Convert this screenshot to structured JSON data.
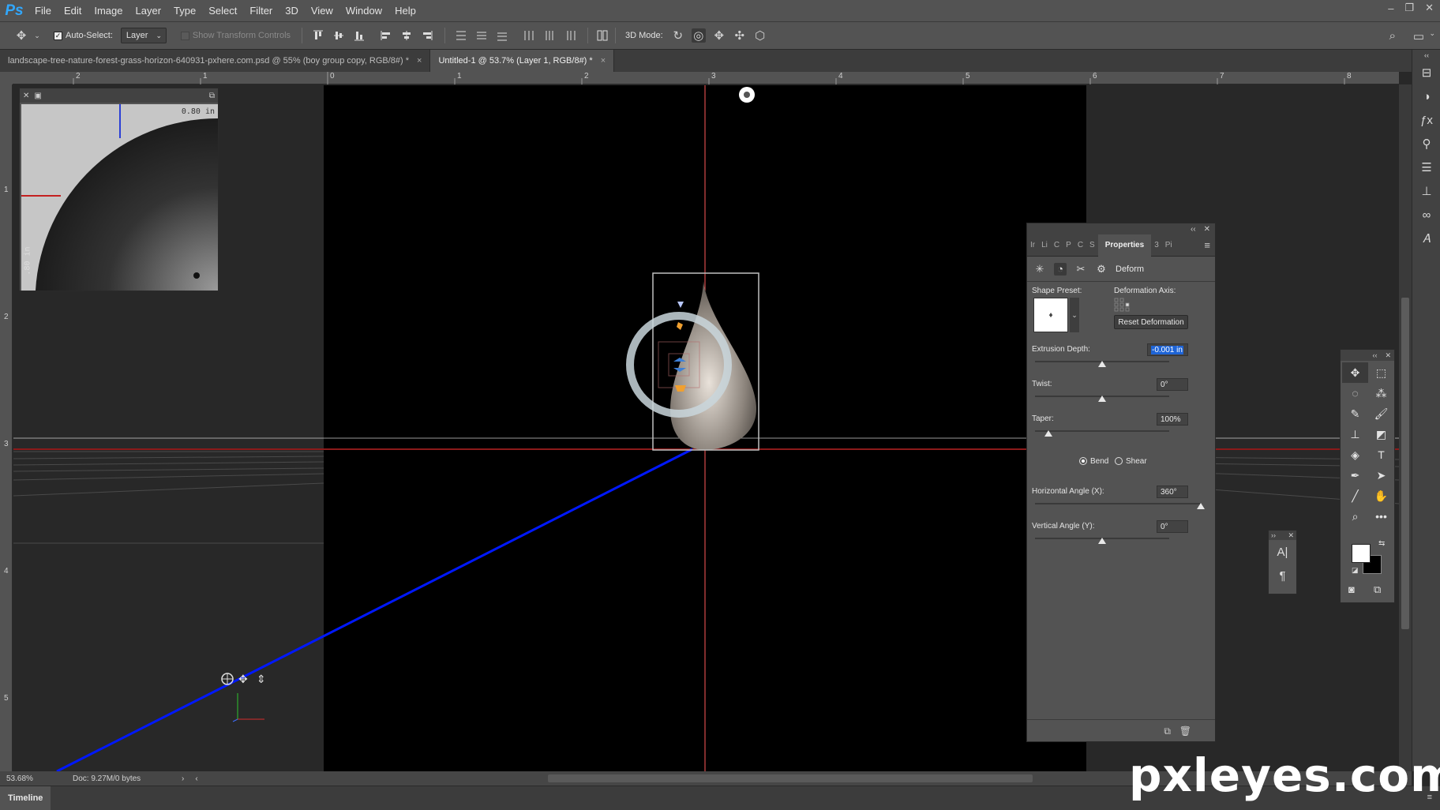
{
  "app": {
    "logo": "Ps"
  },
  "menu": [
    "File",
    "Edit",
    "Image",
    "Layer",
    "Type",
    "Select",
    "Filter",
    "3D",
    "View",
    "Window",
    "Help"
  ],
  "window_controls": {
    "minimize": "‒",
    "restore": "❐",
    "close": "✕"
  },
  "options": {
    "auto_select_label": "Auto-Select:",
    "auto_select_checked": true,
    "auto_select_value": "Layer",
    "show_transform_label": "Show Transform Controls",
    "mode_label": "3D Mode:"
  },
  "tabs": [
    {
      "label": "landscape-tree-nature-forest-grass-horizon-640931-pxhere.com.psd @ 55% (boy group copy, RGB/8#) *",
      "close": "×",
      "active": false
    },
    {
      "label": "Untitled-1 @ 53.7% (Layer 1, RGB/8#) *",
      "close": "×",
      "active": true
    }
  ],
  "ruler": {
    "h_ticks": [
      "2",
      "1",
      "0",
      "1",
      "2",
      "3",
      "4",
      "5",
      "6",
      "7",
      "8"
    ],
    "v_ticks": [
      "1",
      "2",
      "3",
      "4",
      "5"
    ]
  },
  "nav_panel": {
    "readout_top": "0.80 in",
    "readout_side": ".80 in"
  },
  "properties": {
    "collapse": "‹‹",
    "close": "✕",
    "tabs": [
      "Ir",
      "Li",
      "C",
      "P",
      "C",
      "S",
      "Properties",
      "3",
      "Pi"
    ],
    "active_tab": "Properties",
    "section": "Deform",
    "shape_preset_label": "Shape Preset:",
    "deformation_axis_label": "Deformation Axis:",
    "reset_label": "Reset Deformation",
    "extrusion_label": "Extrusion Depth:",
    "extrusion_value": "-0.001 in",
    "twist_label": "Twist:",
    "twist_value": "0°",
    "taper_label": "Taper:",
    "taper_value": "100%",
    "bend_label": "Bend",
    "shear_label": "Shear",
    "mode_selected": "Bend",
    "h_angle_label": "Horizontal Angle (X):",
    "h_angle_value": "360°",
    "v_angle_label": "Vertical Angle (Y):",
    "v_angle_value": "0°",
    "sliders": {
      "extrusion": 0.5,
      "twist": 0.5,
      "taper": 0.1,
      "h_angle": 1.0,
      "v_angle": 0.5
    }
  },
  "mini_panel": {
    "collapse": "››",
    "close": "✕"
  },
  "tools_panel": {
    "collapse": "‹‹",
    "close": "✕"
  },
  "status": {
    "zoom": "53.68%",
    "doc": "Doc: 9.27M/0 bytes",
    "arrow": "›",
    "scroll_left": "‹"
  },
  "timeline": {
    "label": "Timeline"
  },
  "watermark": "pxleyes.com",
  "colors": {
    "accent": "#31a8ff",
    "guide": "#ff5a5a",
    "axis_line": "#0018ff",
    "field_sel": "#1e64d6"
  }
}
